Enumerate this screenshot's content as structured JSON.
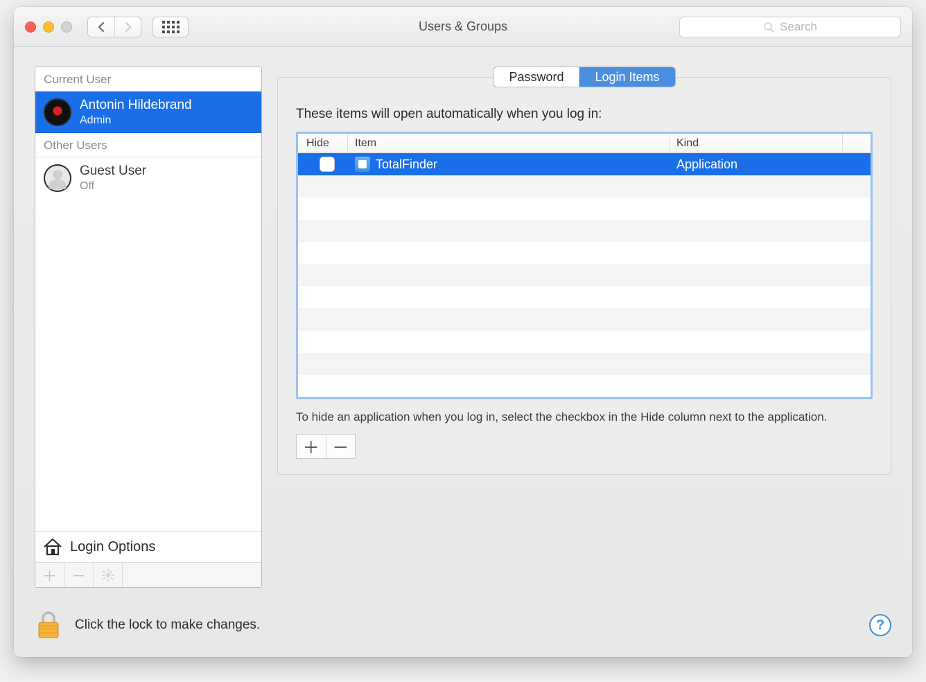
{
  "window": {
    "title": "Users & Groups",
    "search_placeholder": "Search"
  },
  "sidebar": {
    "current_user_label": "Current User",
    "other_users_label": "Other Users",
    "current_user": {
      "name": "Antonin Hildebrand",
      "role": "Admin"
    },
    "other_users": [
      {
        "name": "Guest User",
        "role": "Off"
      }
    ],
    "login_options_label": "Login Options"
  },
  "tabs": {
    "password": "Password",
    "login_items": "Login Items"
  },
  "main": {
    "heading": "These items will open automatically when you log in:",
    "columns": {
      "hide": "Hide",
      "item": "Item",
      "kind": "Kind"
    },
    "rows": [
      {
        "hide": false,
        "item": "TotalFinder",
        "kind": "Application"
      }
    ],
    "hint": "To hide an application when you log in, select the checkbox in the Hide column next to the application."
  },
  "footer": {
    "lock_text": "Click the lock to make changes."
  }
}
